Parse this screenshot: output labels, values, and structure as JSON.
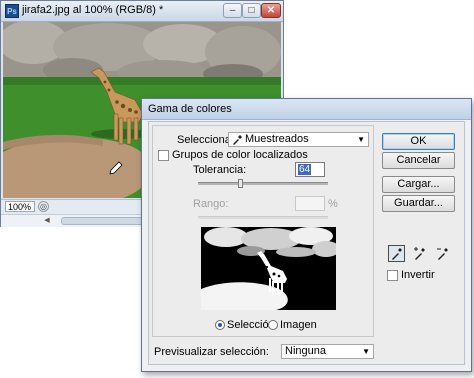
{
  "document_window": {
    "app_icon": "photoshop-icon",
    "title": "jirafa2.jpg al 100% (RGB/8) *",
    "controls": {
      "minimize": "–",
      "maximize": "□",
      "close": "✕"
    },
    "zoom": "100%",
    "image": "giraffe-photo"
  },
  "dialog": {
    "title": "Gama de colores",
    "select_label": "Seleccionar:",
    "select_value": "Muestreados",
    "select_icon": "eyedropper-icon",
    "localized_groups_label": "Grupos de color localizados",
    "localized_groups_checked": false,
    "tolerance_label": "Tolerancia:",
    "tolerance_value": "64",
    "tolerance_max": 200,
    "range_label": "Rango:",
    "range_value": "",
    "range_unit": "%",
    "preview_mode_options": [
      "Selección",
      "Imagen"
    ],
    "preview_mode_selected": "Selección",
    "preview_selection_label": "Previsualizar selección:",
    "preview_selection_value": "Ninguna",
    "buttons": {
      "ok": "OK",
      "cancel": "Cancelar",
      "load": "Cargar...",
      "save": "Guardar..."
    },
    "eyedropper_tools": [
      "eyedropper-icon",
      "eyedropper-plus-icon",
      "eyedropper-minus-icon"
    ],
    "invert_label": "Invertir",
    "invert_checked": false
  },
  "colors": {
    "grass": "#3f8f2c",
    "path": "#b89876",
    "rock": "#a39f98",
    "titlebar": "#c0d1e6",
    "highlight": "#3a6ac5"
  }
}
